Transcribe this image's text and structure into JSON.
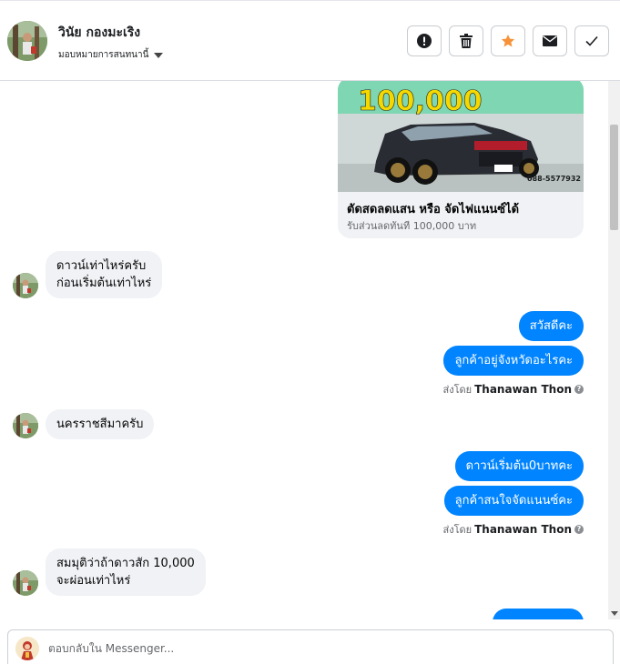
{
  "header": {
    "contact_name": "วินัย กองมะเริง",
    "assign_label": "มอบหมายการสนทนานี้",
    "actions": [
      {
        "name": "report-icon"
      },
      {
        "name": "trash-icon"
      },
      {
        "name": "star-icon",
        "color": "#f7923a"
      },
      {
        "name": "envelope-icon"
      },
      {
        "name": "check-icon"
      }
    ]
  },
  "ad": {
    "image_text": "100,000",
    "phone": "088-5577932",
    "title": "ตัดสดลดแสน หรือ จัดไฟแนนซ์ได้",
    "subtitle": "รับส่วนลดทันที 100,000 บาท"
  },
  "messages": {
    "m1_line1": "ดาวน์เท่าไหร่ครับ",
    "m1_line2": "ก่อนเริ่มต้นเท่าไหร่",
    "m2": "สวัสดีคะ",
    "m3": "ลูกค้าอยู่จังหวัดอะไรคะ",
    "sent_by_label_1": "ส่งโดย",
    "sent_by_name_1": "Thanawan Thon",
    "m4": "นครราชสีมาครับ",
    "m5": "ดาวน์เริ่มต้น0บาทคะ",
    "m6": "ลูกค้าสนใจจัดแนนซ์คะ",
    "sent_by_label_2": "ส่งโดย",
    "sent_by_name_2": "Thanawan Thon",
    "m7_line1": "สมมุติว่าถ้าดาวสัก 10,000",
    "m7_line2": "จะผ่อนเท่าไหร่"
  },
  "reply": {
    "placeholder": "ตอบกลับใน Messenger..."
  },
  "colors": {
    "outgoing_bubble": "#0084ff",
    "incoming_bubble": "#f0f2f5",
    "star": "#f7923a"
  }
}
